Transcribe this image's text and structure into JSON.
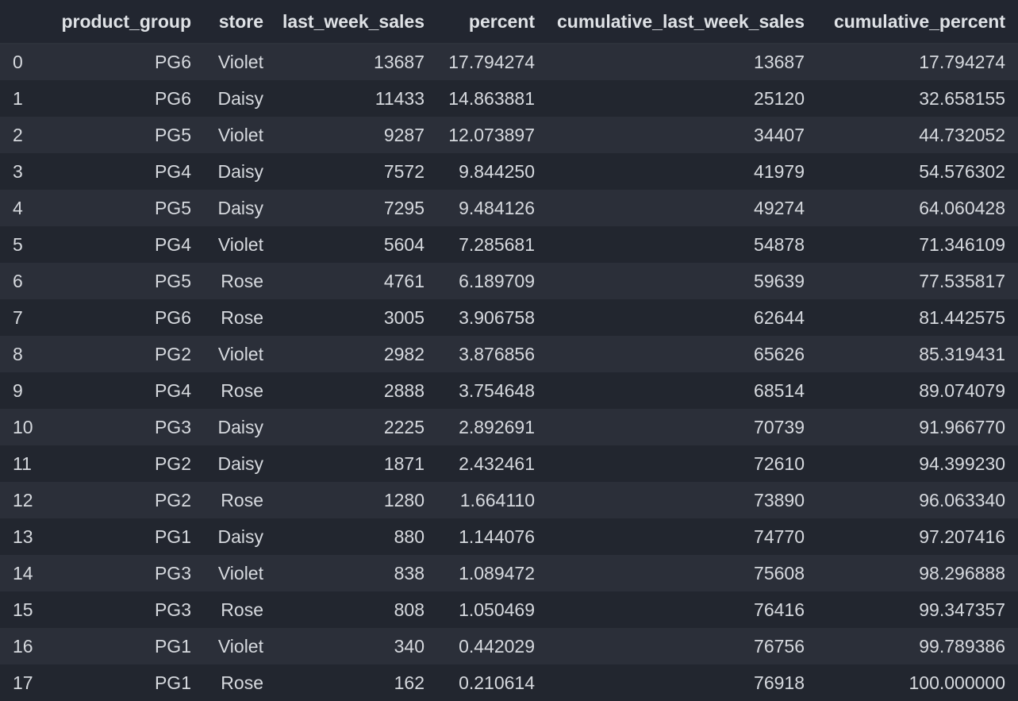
{
  "dataframe": {
    "columns": [
      "",
      "product_group",
      "store",
      "last_week_sales",
      "percent",
      "cumulative_last_week_sales",
      "cumulative_percent"
    ],
    "rows": [
      [
        "0",
        "PG6",
        "Violet",
        "13687",
        "17.794274",
        "13687",
        "17.794274"
      ],
      [
        "1",
        "PG6",
        "Daisy",
        "11433",
        "14.863881",
        "25120",
        "32.658155"
      ],
      [
        "2",
        "PG5",
        "Violet",
        "9287",
        "12.073897",
        "34407",
        "44.732052"
      ],
      [
        "3",
        "PG4",
        "Daisy",
        "7572",
        "9.844250",
        "41979",
        "54.576302"
      ],
      [
        "4",
        "PG5",
        "Daisy",
        "7295",
        "9.484126",
        "49274",
        "64.060428"
      ],
      [
        "5",
        "PG4",
        "Violet",
        "5604",
        "7.285681",
        "54878",
        "71.346109"
      ],
      [
        "6",
        "PG5",
        "Rose",
        "4761",
        "6.189709",
        "59639",
        "77.535817"
      ],
      [
        "7",
        "PG6",
        "Rose",
        "3005",
        "3.906758",
        "62644",
        "81.442575"
      ],
      [
        "8",
        "PG2",
        "Violet",
        "2982",
        "3.876856",
        "65626",
        "85.319431"
      ],
      [
        "9",
        "PG4",
        "Rose",
        "2888",
        "3.754648",
        "68514",
        "89.074079"
      ],
      [
        "10",
        "PG3",
        "Daisy",
        "2225",
        "2.892691",
        "70739",
        "91.966770"
      ],
      [
        "11",
        "PG2",
        "Daisy",
        "1871",
        "2.432461",
        "72610",
        "94.399230"
      ],
      [
        "12",
        "PG2",
        "Rose",
        "1280",
        "1.664110",
        "73890",
        "96.063340"
      ],
      [
        "13",
        "PG1",
        "Daisy",
        "880",
        "1.144076",
        "74770",
        "97.207416"
      ],
      [
        "14",
        "PG3",
        "Violet",
        "838",
        "1.089472",
        "75608",
        "98.296888"
      ],
      [
        "15",
        "PG3",
        "Rose",
        "808",
        "1.050469",
        "76416",
        "99.347357"
      ],
      [
        "16",
        "PG1",
        "Violet",
        "340",
        "0.442029",
        "76756",
        "99.789386"
      ],
      [
        "17",
        "PG1",
        "Rose",
        "162",
        "0.210614",
        "76918",
        "100.000000"
      ]
    ]
  },
  "colors": {
    "background": "#222630",
    "row_even": "#2b2f39",
    "row_odd": "#22262f",
    "text": "#d6d9de"
  }
}
